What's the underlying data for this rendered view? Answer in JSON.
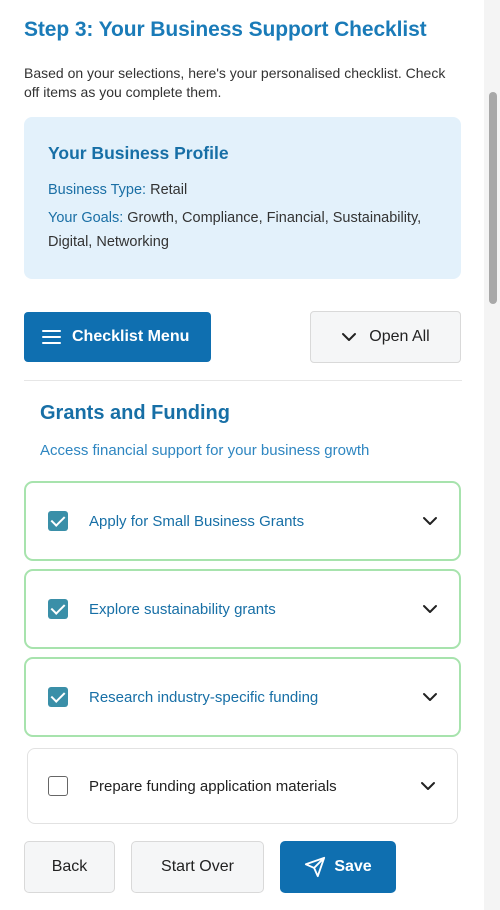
{
  "header": {
    "title": "Step 3: Your Business Support Checklist",
    "intro": "Based on your selections, here's your personalised checklist. Check off items as you complete them."
  },
  "profile": {
    "title": "Your Business Profile",
    "business_type_label": "Business Type:",
    "business_type_value": "Retail",
    "goals_label": "Your Goals:",
    "goals_value": "Growth, Compliance, Financial, Sustainability, Digital, Networking"
  },
  "toolbar": {
    "menu_label": "Checklist Menu",
    "open_all_label": "Open All"
  },
  "section": {
    "title": "Grants and Funding",
    "description": "Access financial support for your business growth",
    "items": [
      {
        "label": "Apply for Small Business Grants",
        "checked": true
      },
      {
        "label": "Explore sustainability grants",
        "checked": true
      },
      {
        "label": "Research industry-specific funding",
        "checked": true
      },
      {
        "label": "Prepare funding application materials",
        "checked": false
      }
    ]
  },
  "footer": {
    "back_label": "Back",
    "start_over_label": "Start Over",
    "save_label": "Save"
  },
  "colors": {
    "primary": "#0f6fb0",
    "heading": "#176fa6",
    "profile_bg": "#e3f1fb",
    "checked_border": "#a7e3ad",
    "checkbox": "#3a8fa8"
  },
  "icons": [
    "hamburger-icon",
    "chevron-down-icon",
    "checkbox-checked-icon",
    "checkbox-empty-icon",
    "send-icon"
  ]
}
